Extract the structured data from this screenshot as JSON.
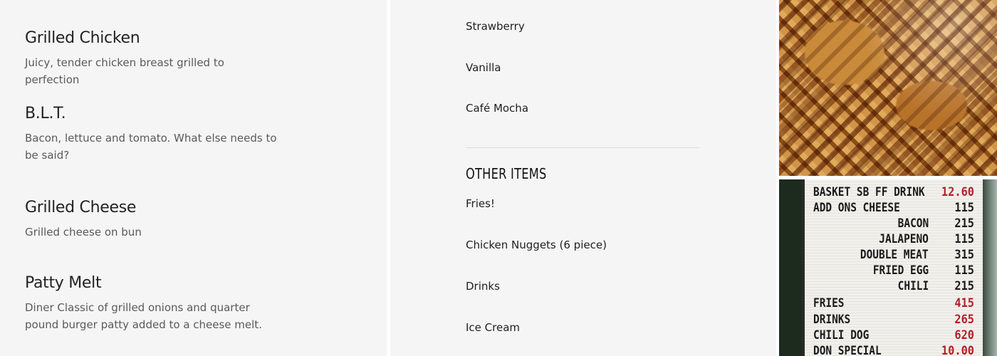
{
  "menu": {
    "items": [
      {
        "name": "Grilled Chicken",
        "description": "Juicy, tender chicken breast grilled to perfection"
      },
      {
        "name": "B.L.T.",
        "description": "Bacon, lettuce and tomato. What else needs to be said?"
      },
      {
        "name": "Grilled Cheese",
        "description": "Grilled cheese on bun"
      },
      {
        "name": "Patty Melt",
        "description": "Diner Classic of grilled onions and quarter pound burger patty added to a cheese melt."
      }
    ]
  },
  "shakes": {
    "flavors": [
      "Strawberry",
      "Vanilla",
      "Café Mocha"
    ]
  },
  "other_items": {
    "heading": "OTHER ITEMS",
    "items": [
      "Fries!",
      "Chicken Nuggets (6 piece)",
      "Drinks",
      "Ice Cream"
    ]
  },
  "menu_board": {
    "lines": [
      {
        "label": "BASKET SB FF DRINK",
        "price": "12.60",
        "price_color": "red"
      },
      {
        "label": "ADD ONS CHEESE",
        "price": "115",
        "price_color": "black"
      },
      {
        "label": "BACON",
        "price": "215",
        "price_color": "black"
      },
      {
        "label": "JALAPENO",
        "price": "115",
        "price_color": "black"
      },
      {
        "label": "DOUBLE MEAT",
        "price": "315",
        "price_color": "black"
      },
      {
        "label": "FRIED EGG",
        "price": "115",
        "price_color": "black"
      },
      {
        "label": "CHILI",
        "price": "215",
        "price_color": "black"
      },
      {
        "label": "FRIES",
        "price": "415",
        "price_color": "red"
      },
      {
        "label": "DRINKS",
        "price": "265",
        "price_color": "red"
      },
      {
        "label": "CHILI DOG",
        "price": "620",
        "price_color": "red"
      },
      {
        "label": "DON SPECIAL",
        "price": "10.00",
        "price_color": "red"
      }
    ]
  },
  "colors": {
    "panel_bg": "#f5f5f5",
    "text_dark": "#222222",
    "text_muted": "#5a5a5a",
    "board_red": "#b3202a"
  }
}
